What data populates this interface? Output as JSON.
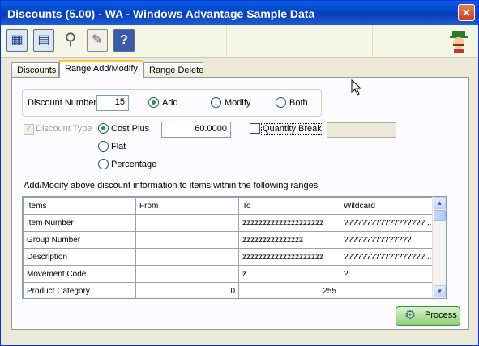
{
  "window": {
    "title": "Discounts (5.00) - WA - Windows Advantage Sample Data",
    "close_glyph": "✕"
  },
  "toolbar": {
    "buttons": [
      {
        "icon": "calculator-icon",
        "glyph": "▦"
      },
      {
        "icon": "calendar-icon",
        "glyph": "▤"
      },
      {
        "icon": "magnifier-icon",
        "glyph": "⚲"
      },
      {
        "icon": "checklist-icon",
        "glyph": "✎"
      },
      {
        "icon": "help-book-icon",
        "glyph": "?"
      }
    ]
  },
  "tabs": [
    {
      "label": "Discounts",
      "active": false
    },
    {
      "label": "Range Add/Modify",
      "active": true
    },
    {
      "label": "Range Delete",
      "active": false
    }
  ],
  "form": {
    "discount_number_label": "Discount Number",
    "discount_number": "15",
    "mode_options": [
      "Add",
      "Modify",
      "Both"
    ],
    "mode_selected": "Add",
    "discount_type_label": "Discount Type",
    "discount_type_checked": true,
    "discount_type_enabled": false,
    "type_options": [
      "Cost Plus",
      "Flat",
      "Percentage"
    ],
    "type_selected": "Cost Plus",
    "cost_value": "60.0000",
    "quantity_break_label": "Quantity Break",
    "quantity_break_checked": false,
    "quantity_break_value": ""
  },
  "ranges": {
    "caption": "Add/Modify above discount information to items within the following ranges",
    "columns": [
      "Items",
      "From",
      "To",
      "Wildcard"
    ],
    "rows": [
      {
        "item": "Item Number",
        "from": "",
        "to": "zzzzzzzzzzzzzzzzzzzz",
        "wildcard": "??????????????????..."
      },
      {
        "item": "Group Number",
        "from": "",
        "to": "zzzzzzzzzzzzzzz",
        "wildcard": "???????????????"
      },
      {
        "item": "Description",
        "from": "",
        "to": "zzzzzzzzzzzzzzzzzzzz",
        "wildcard": "??????????????????..."
      },
      {
        "item": "Movement Code",
        "from": "",
        "to": "z",
        "wildcard": "?"
      },
      {
        "item": "Product Category",
        "from": "0",
        "to": "255",
        "wildcard": ""
      }
    ]
  },
  "process_button": {
    "label": "Process"
  },
  "colors": {
    "title_bar": "#0a5fe6",
    "tab_highlight": "#ffc83c",
    "process_green": "#8fd07a"
  }
}
